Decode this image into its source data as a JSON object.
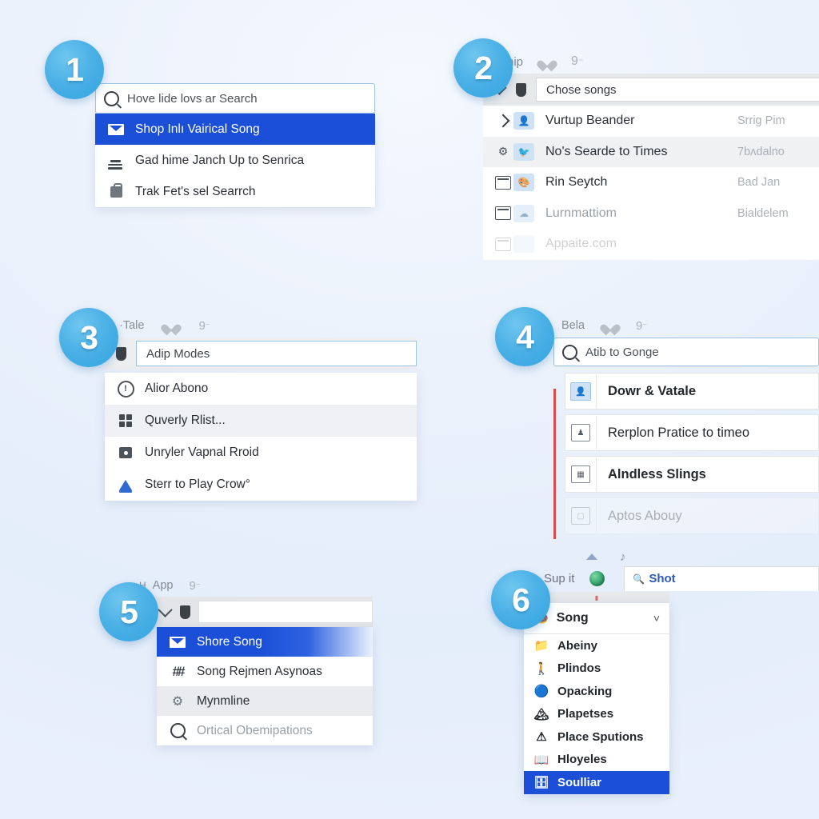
{
  "meta": {
    "accent_blue": "#1b4fd8",
    "badge_blue": "#4cb1e6",
    "red_accent": "#e0494b",
    "background": "#eaf1fb"
  },
  "panels": [
    {
      "badge": "1",
      "search": {
        "placeholder": "Hove lide lovs ar Search",
        "icon": "search-icon"
      },
      "items": [
        {
          "label": "Shop Inlı Vairical Song",
          "icon": "envelope-icon",
          "state": "selected"
        },
        {
          "label": "Gad hime Janch Up to Senrica",
          "icon": "list-lines-icon",
          "state": "normal"
        },
        {
          "label": "Trak Fet's sel Searrch",
          "icon": "briefcase-icon",
          "state": "normal"
        }
      ]
    },
    {
      "badge": "2",
      "toolbar": {
        "title": "Ahip",
        "icons": [
          "heart-icon",
          "key-icon"
        ]
      },
      "input": {
        "value": "Chose songs",
        "chevron": "chevron-down-icon",
        "tag": "tag-icon"
      },
      "rows": [
        {
          "lead": "chevron-right-icon",
          "tile": "user-tile-icon",
          "name": "Vurtup Beander",
          "sub": "Srrig Pim",
          "state": "normal"
        },
        {
          "lead": "gear-icon",
          "tile": "bird-tile-icon",
          "name": "No's Searde to Times",
          "sub": "7bʌdalno",
          "state": "alt"
        },
        {
          "lead": "window-icon",
          "tile": "paint-tile-icon",
          "name": "Rin Seytch",
          "sub": "Bad Jan",
          "state": "normal"
        },
        {
          "lead": "window-icon",
          "tile": "cloud-tile-icon",
          "name": "Lurnmattiom",
          "sub": "Bialdelem",
          "state": "normal"
        },
        {
          "lead": "window-icon",
          "tile": "blank-tile-icon",
          "name": "Appaite.com",
          "sub": "",
          "state": "faded"
        }
      ]
    },
    {
      "badge": "3",
      "toolbar": {
        "title": "·Tale",
        "icons": [
          "heart-icon",
          "key-icon"
        ]
      },
      "input": {
        "value": "Adip Modes",
        "tag": "tag-icon"
      },
      "items": [
        {
          "label": "Alior Abono",
          "icon": "exclamation-circle-icon",
          "state": "normal"
        },
        {
          "label": "Quverly Rlist...",
          "icon": "grid-icon",
          "state": "alt"
        },
        {
          "label": "Unryler Vapnal Rroid",
          "icon": "image-icon",
          "state": "normal"
        },
        {
          "label": "Sterr to Play Crow°",
          "icon": "stand-icon",
          "state": "normal"
        }
      ]
    },
    {
      "badge": "4",
      "toolbar": {
        "title": "Bela",
        "icons": [
          "heart-icon",
          "key-icon"
        ]
      },
      "search": {
        "placeholder": "Atib to Gonge",
        "icon": "search-icon"
      },
      "items": [
        {
          "label": "Dowr & Vatale",
          "icon": "user-tile-icon",
          "state": "bold"
        },
        {
          "label": "Rerplon Pratice to timeo",
          "icon": "framed-person-icon",
          "state": "plain"
        },
        {
          "label": "Alndless Slings",
          "icon": "framed-card-icon",
          "state": "bold"
        },
        {
          "label": "Aptos Abouy",
          "icon": "framed-image-icon",
          "state": "faded"
        }
      ]
    },
    {
      "badge": "5",
      "toolbar": {
        "title_prefix": "H",
        "title": "App",
        "icons": [
          "key-icon"
        ]
      },
      "input": {
        "value": "",
        "chevron": "chevron-down-icon",
        "tag": "tag-icon"
      },
      "items": [
        {
          "label": "Shore Song",
          "icon": "envelope-card-icon",
          "state": "selected"
        },
        {
          "label": "Song Rejmen Asynoas",
          "icon": "double-sharp-icon",
          "state": "normal"
        },
        {
          "label": "Mynmline",
          "icon": "gear-icon",
          "state": "alt"
        },
        {
          "label": "Ortical Obemipations",
          "icon": "search-icon",
          "state": "dim"
        }
      ]
    },
    {
      "badge": "6",
      "toolbar": {
        "title": "Sup it",
        "icons": [
          "arrow-up-icon",
          "note-icon"
        ]
      },
      "globe": "globe-icon",
      "tab": {
        "label": "Shot",
        "icon": "zoom-icon"
      },
      "header": {
        "label": "Song",
        "icon": "donut-icon",
        "chevron": "chevron-down-icon"
      },
      "items": [
        {
          "label": "Abeiny",
          "icon": "folder-icon",
          "color": "#d9a13c",
          "state": "normal"
        },
        {
          "label": "Plindos",
          "icon": "person-icon",
          "color": "#6b6b6b",
          "state": "normal"
        },
        {
          "label": "Opacking",
          "icon": "sphere-icon",
          "color": "#2f7ec4",
          "state": "normal"
        },
        {
          "label": "Plapetses",
          "icon": "landscape-icon",
          "color": "#3f8f5c",
          "state": "normal"
        },
        {
          "label": "Place Sputions",
          "icon": "warning-icon",
          "color": "#e8b93a",
          "state": "normal"
        },
        {
          "label": "Hloyeles",
          "icon": "book-icon",
          "color": "#9b6fc0",
          "state": "normal"
        },
        {
          "label": "Soulliar",
          "icon": "stack-icon",
          "color": "#5a8fd0",
          "state": "selected"
        }
      ]
    }
  ]
}
